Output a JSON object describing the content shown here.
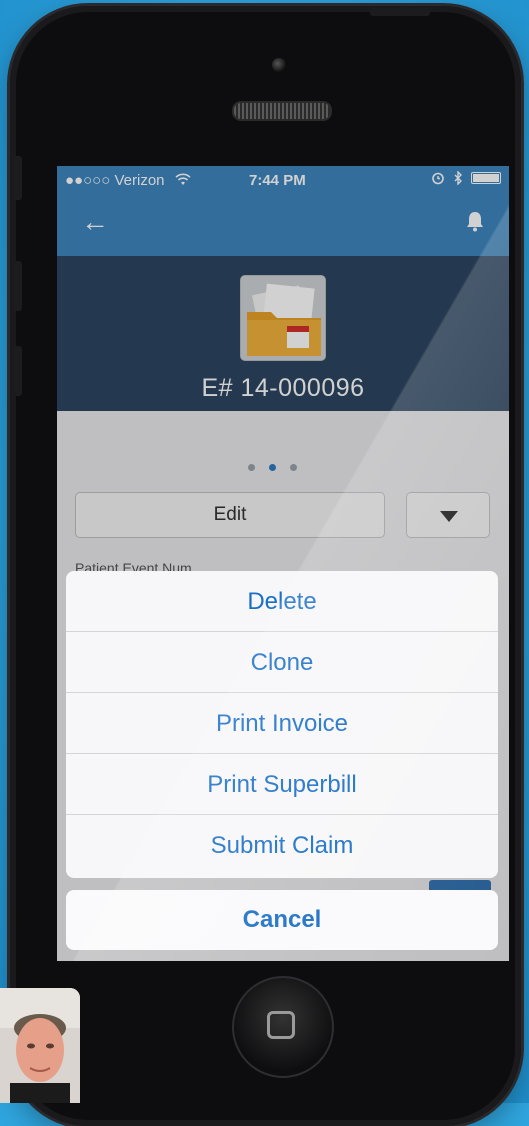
{
  "status_bar": {
    "carrier": "●●○○○ Verizon",
    "time": "7:44 PM"
  },
  "header": {
    "event_number": "E# 14-000096"
  },
  "actions": {
    "edit_label": "Edit"
  },
  "fields": {
    "patient_event_label": "Patient Event Num"
  },
  "action_sheet": {
    "items": [
      "Delete",
      "Clone",
      "Print Invoice",
      "Print Superbill",
      "Submit Claim"
    ],
    "cancel_label": "Cancel"
  },
  "icons": [
    "back-arrow-icon",
    "bell-icon",
    "wifi-icon",
    "alarm-icon",
    "bluetooth-icon",
    "battery-icon",
    "chevron-down-icon",
    "folder-icon"
  ],
  "colors": {
    "nav_blue": "#3e86be",
    "header_navy": "#2d4661",
    "sheet_text_blue": "#1a6fc6",
    "page_active_dot": "#2e7bbd"
  }
}
